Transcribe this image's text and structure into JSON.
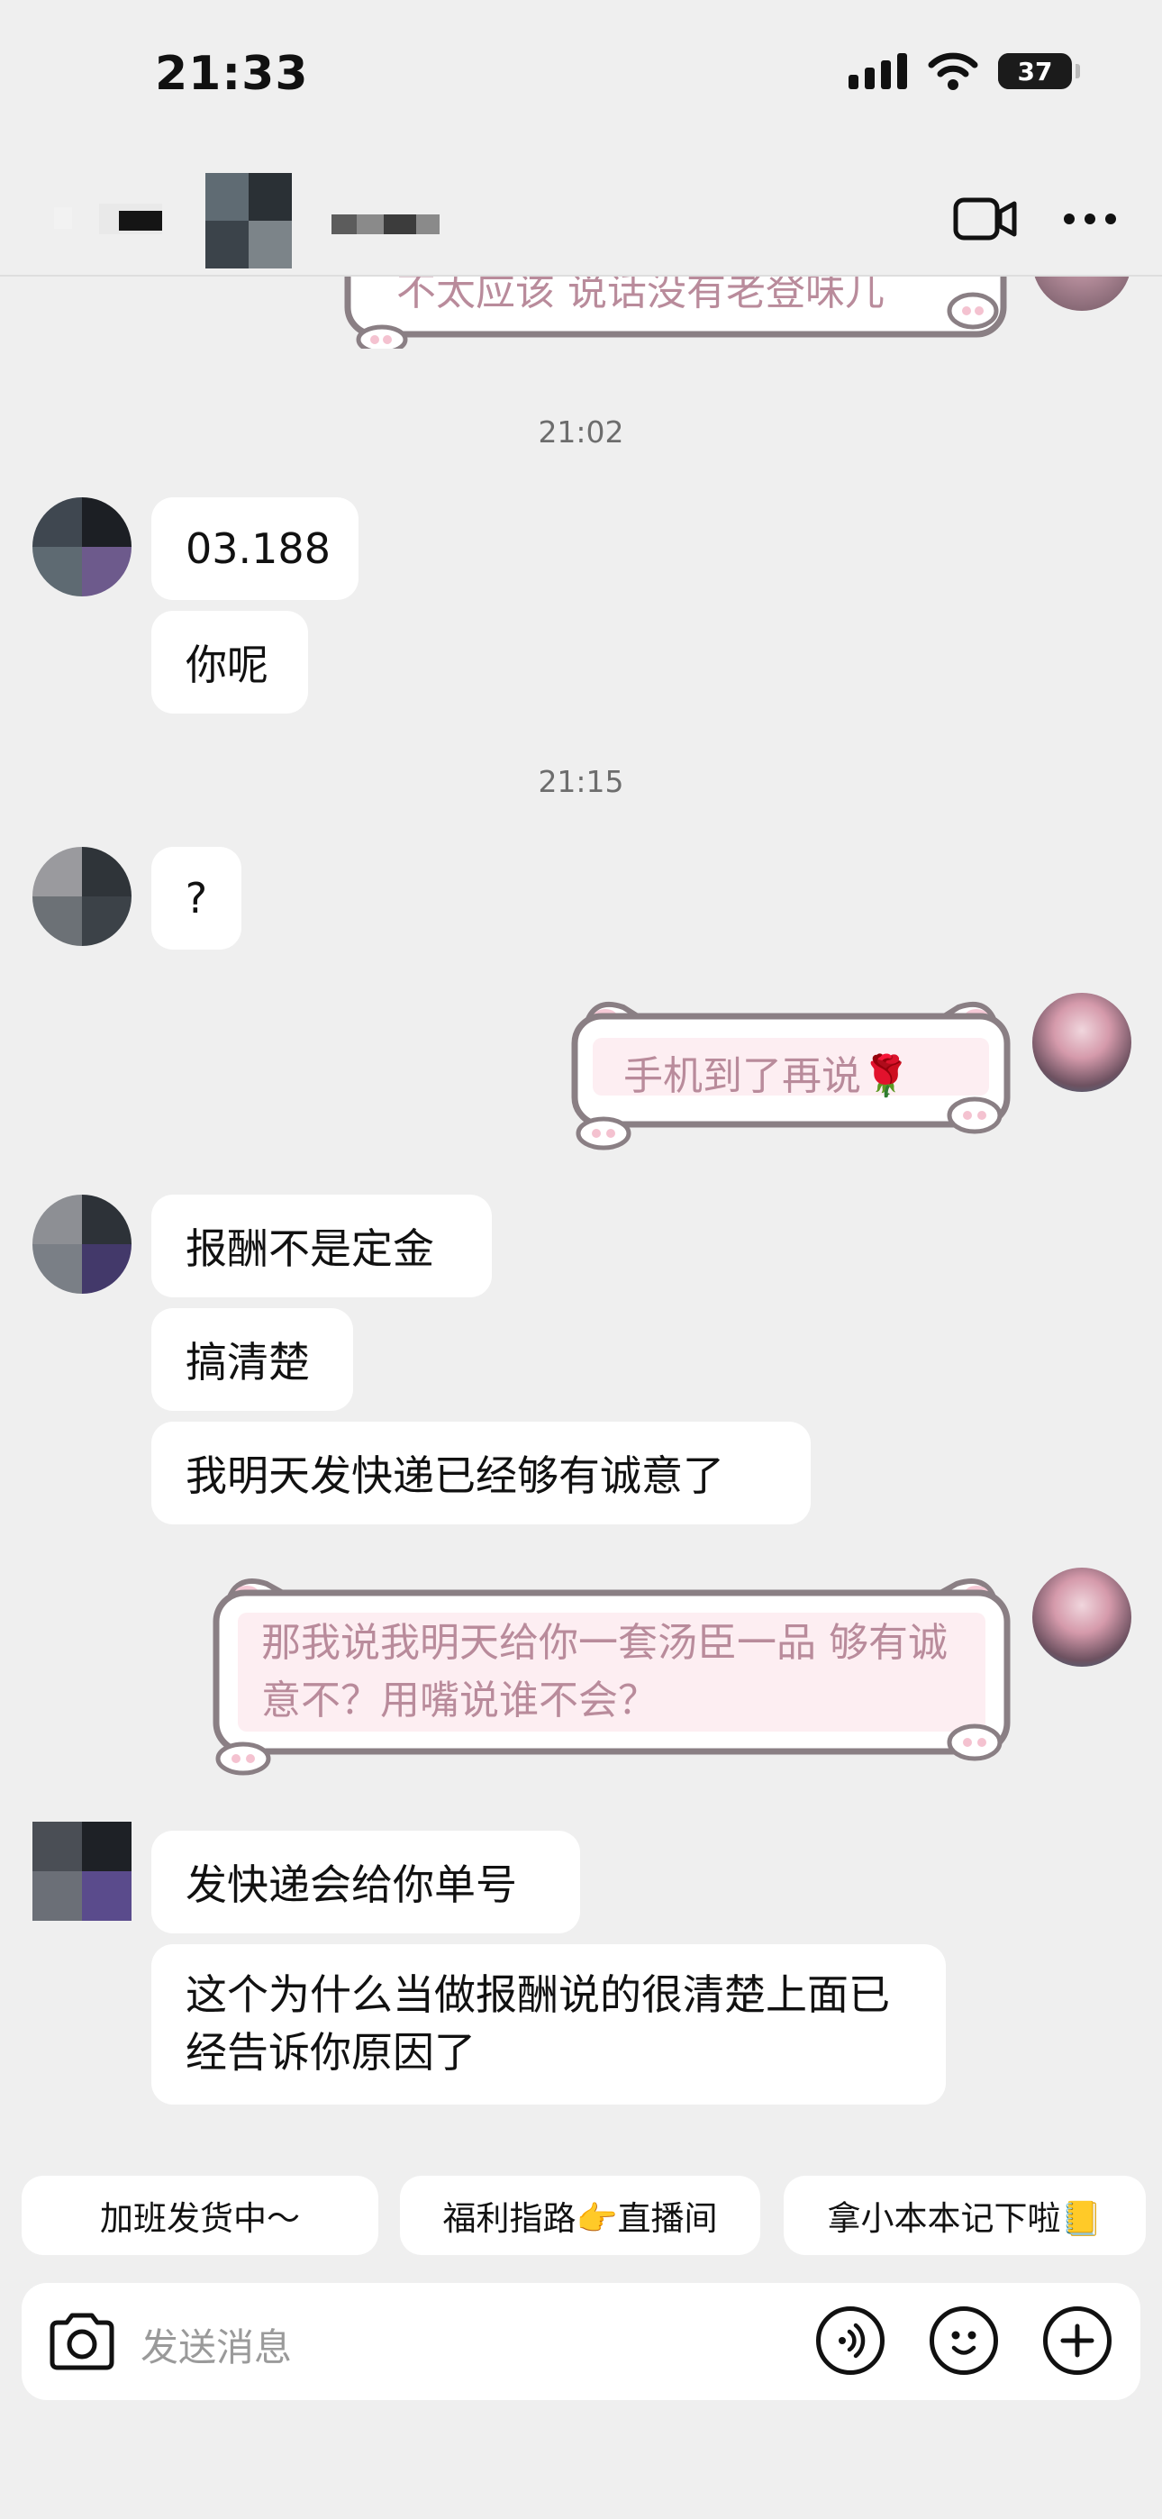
{
  "status_bar": {
    "time": "21:33",
    "battery": "37"
  },
  "header": {
    "more_icon": "more-icon",
    "video_icon": "video-call-icon"
  },
  "messages": {
    "top_partial": "不太应该 说话没有老登味儿",
    "ts1": "21:02",
    "m1": "03.188",
    "m2": "你呢",
    "ts2": "21:15",
    "m3": "?",
    "out1": "手机到了再说🌹",
    "m4": "报酬不是定金",
    "m5": "搞清楚",
    "m6": "我明天发快递已经够有诚意了",
    "out2": "那我说我明天给你一套汤臣一品 够有诚意不？用嘴说谁不会？",
    "m7": "发快递会给你单号",
    "m8": "这个为什么当做报酬说的很清楚上面已经告诉你原因了"
  },
  "quick_replies": [
    "加班发货中～",
    "福利指路👉直播间",
    "拿小本本记下啦📒"
  ],
  "input": {
    "placeholder": "发送消息"
  }
}
